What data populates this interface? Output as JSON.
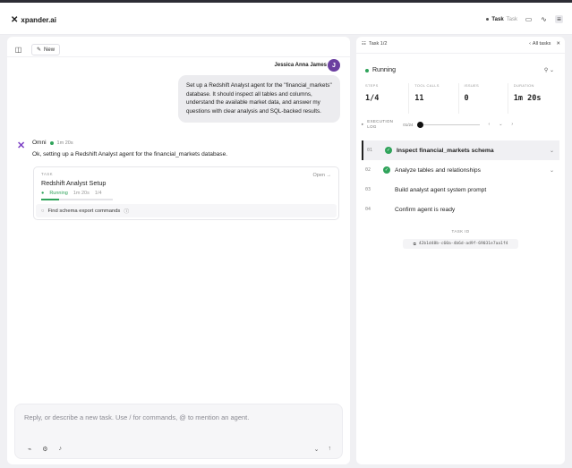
{
  "app": {
    "brand": "xpander.ai"
  },
  "topbar": {
    "agent_label": "Task",
    "agent_value": "Task"
  },
  "left": {
    "new_label": "New",
    "user": {
      "name": "Jessica Anna James",
      "initial": "J",
      "message": "Set up a Redshift Analyst agent for the \"financial_markets\" database. It should inspect all tables and columns, understand the available market data, and answer my questions with clear analysis and SQL-backed results."
    },
    "agent": {
      "name": "Omni",
      "time": "1m 20s",
      "message": "Ok, setting up a Redshift Analyst agent for the financial_markets database."
    },
    "task_card": {
      "label": "TASK",
      "title": "Redshift Analyst Setup",
      "open": "Open",
      "status": "Running",
      "time": "1m 20s",
      "progress": "1/4",
      "progress_fraction": 0.25,
      "subtask": "Find schema export commands"
    },
    "input_placeholder": "Reply, or describe a new task. Use / for commands, @ to mention an agent."
  },
  "right": {
    "task_nav": "Task 1/2",
    "all_tasks": "All tasks",
    "status": "Running",
    "stats": [
      {
        "label": "STEPS",
        "value": "1/4"
      },
      {
        "label": "TOOL CALLS",
        "value": "11"
      },
      {
        "label": "ISSUES",
        "value": "0"
      },
      {
        "label": "DURATION",
        "value": "1m 20s"
      }
    ],
    "exec_label": "EXECUTION LOG",
    "exec_pos": "01/24",
    "steps": [
      {
        "num": "01",
        "label": "Inspect financial_markets schema",
        "done": true
      },
      {
        "num": "02",
        "label": "Analyze tables and relationships",
        "done": true
      },
      {
        "num": "03",
        "label": "Build analyst agent system prompt",
        "done": false
      },
      {
        "num": "04",
        "label": "Confirm agent is ready",
        "done": false
      }
    ],
    "task_id_label": "TASK ID",
    "task_id": "42b1d48b-c60a-4b6d-ad9f-69031e7aa1f4"
  },
  "colors": {
    "accent": "#7b3fc4",
    "running": "#2fa35a",
    "avatar": "#6b3fa0"
  }
}
